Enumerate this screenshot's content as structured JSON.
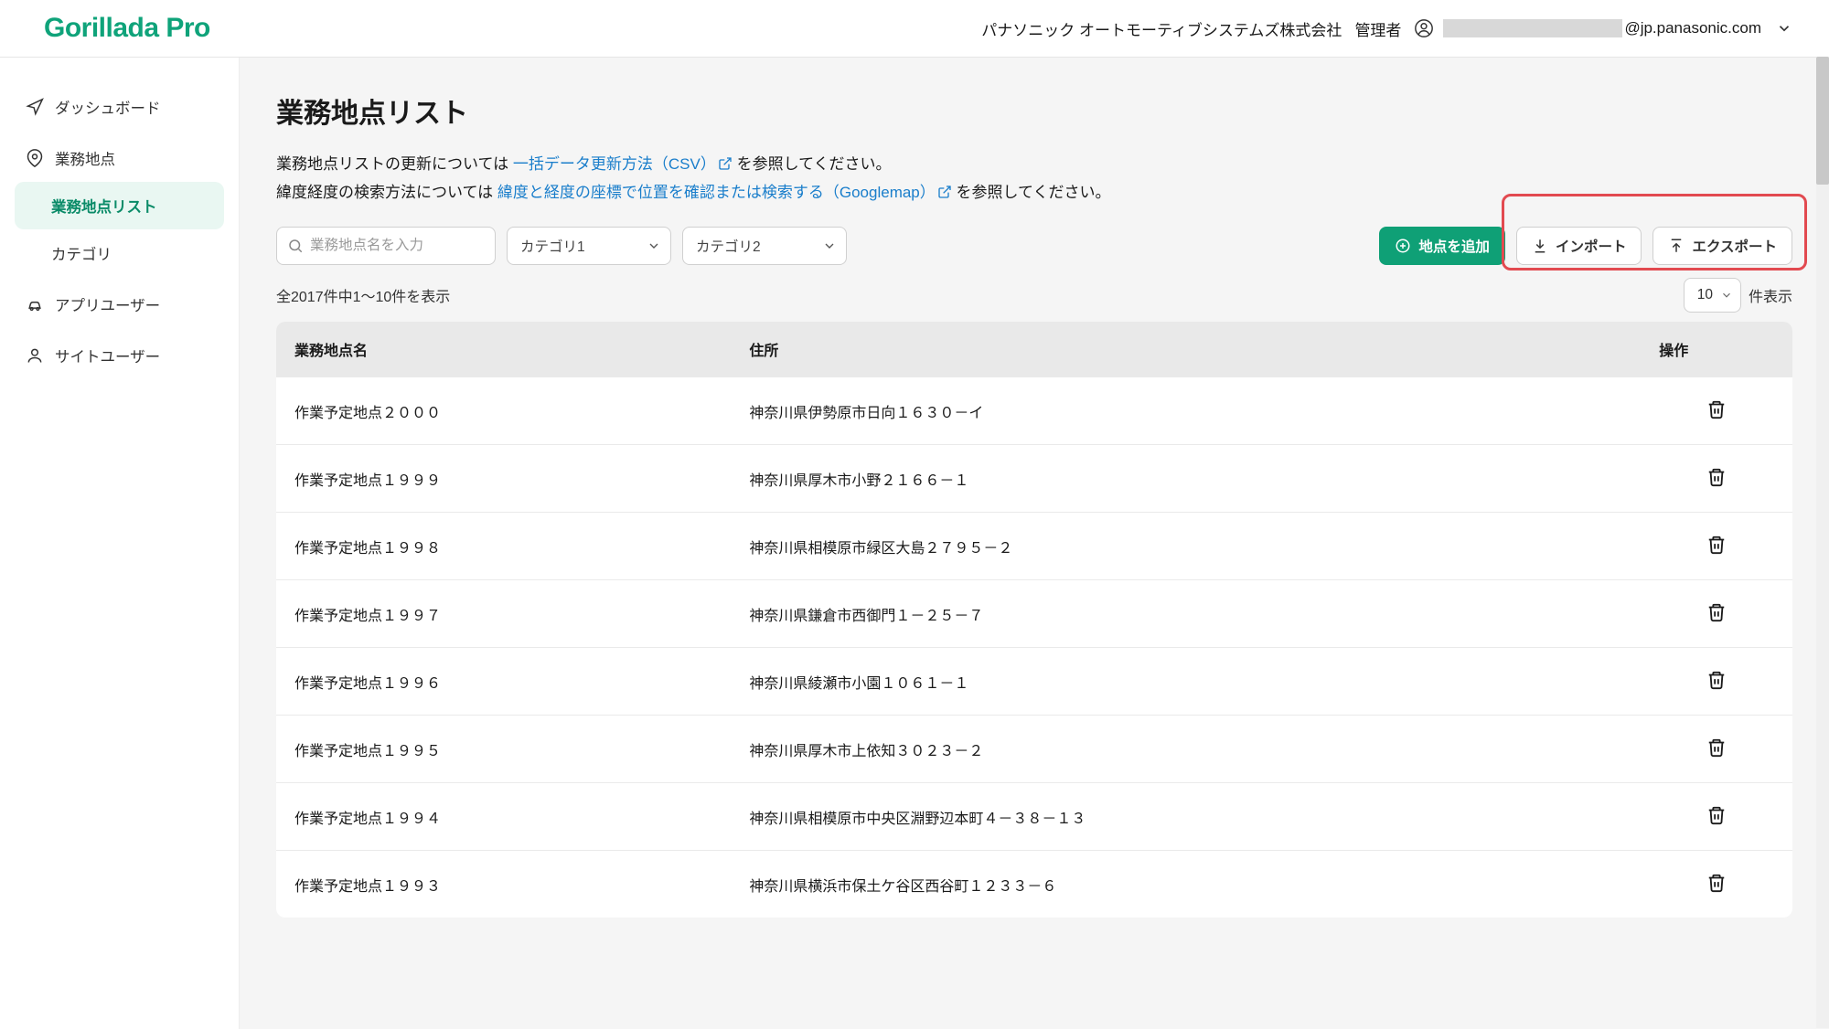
{
  "brand": "Gorillada Pro",
  "company": "パナソニック オートモーティブシステムズ株式会社",
  "role": "管理者",
  "email_suffix": "@jp.panasonic.com",
  "sidebar": {
    "dashboard": "ダッシュボード",
    "locations": "業務地点",
    "location_list": "業務地点リスト",
    "category": "カテゴリ",
    "app_user": "アプリユーザー",
    "site_user": "サイトユーザー"
  },
  "page": {
    "title": "業務地点リスト",
    "help1_pre": "業務地点リストの更新については ",
    "help1_link": "一括データ更新方法（CSV）",
    "help1_post": " を参照してください。",
    "help2_pre": "緯度経度の検索方法については ",
    "help2_link": "緯度と経度の座標で位置を確認または検索する（Googlemap）",
    "help2_post": " を参照してください。"
  },
  "controls": {
    "search_placeholder": "業務地点名を入力",
    "cat1": "カテゴリ1",
    "cat2": "カテゴリ2",
    "add": "地点を追加",
    "import": "インポート",
    "export": "エクスポート"
  },
  "count_text": "全2017件中1～10件を表示",
  "page_size_value": "10",
  "page_size_suffix": "件表示",
  "table": {
    "headers": {
      "name": "業務地点名",
      "addr": "住所",
      "act": "操作"
    },
    "rows": [
      {
        "name": "作業予定地点２０００",
        "addr": "神奈川県伊勢原市日向１６３０－イ"
      },
      {
        "name": "作業予定地点１９９９",
        "addr": "神奈川県厚木市小野２１６６－１"
      },
      {
        "name": "作業予定地点１９９８",
        "addr": "神奈川県相模原市緑区大島２７９５－２"
      },
      {
        "name": "作業予定地点１９９７",
        "addr": "神奈川県鎌倉市西御門１－２５－７"
      },
      {
        "name": "作業予定地点１９９６",
        "addr": "神奈川県綾瀬市小園１０６１－１"
      },
      {
        "name": "作業予定地点１９９５",
        "addr": "神奈川県厚木市上依知３０２３－２"
      },
      {
        "name": "作業予定地点１９９４",
        "addr": "神奈川県相模原市中央区淵野辺本町４－３８－１３"
      },
      {
        "name": "作業予定地点１９９３",
        "addr": "神奈川県横浜市保土ケ谷区西谷町１２３３－６"
      }
    ]
  }
}
